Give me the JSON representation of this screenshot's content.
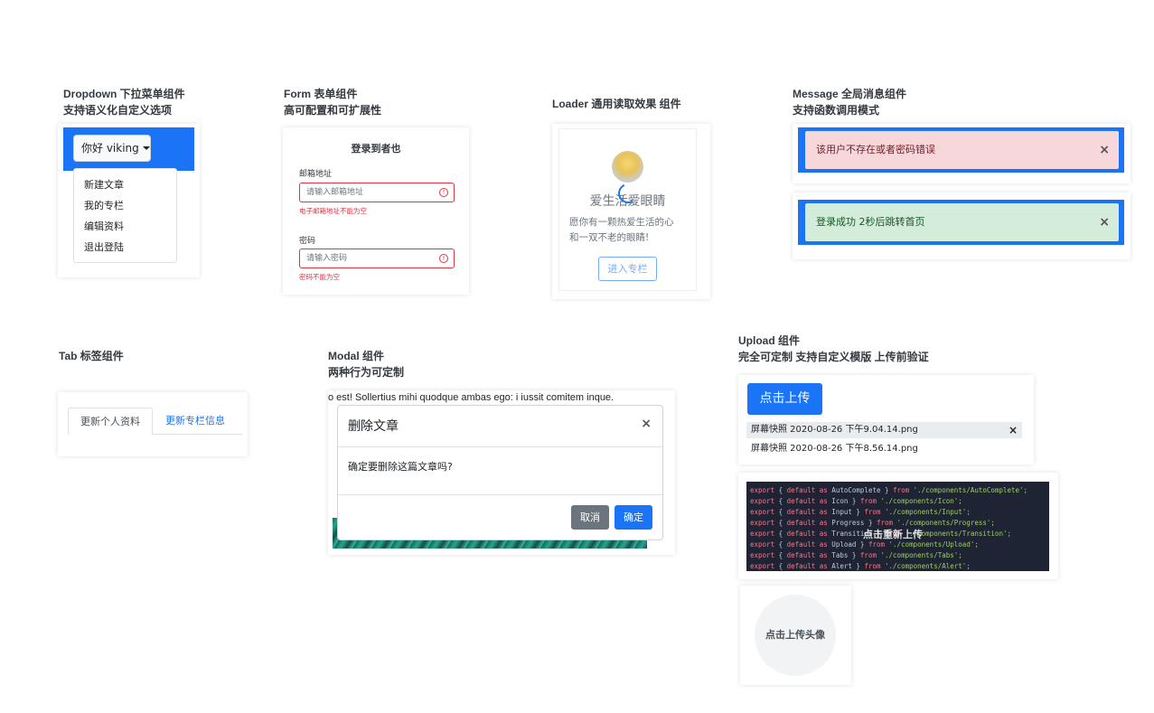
{
  "sections": {
    "dropdown": {
      "title1": "Dropdown 下拉菜单组件",
      "title2": "支持语义化自定义选项"
    },
    "form": {
      "title1": "Form 表单组件",
      "title2": "高可配置和可扩展性"
    },
    "loader": {
      "title1": "Loader 通用读取效果 组件"
    },
    "message": {
      "title1": "Message 全局消息组件",
      "title2": "支持函数调用模式"
    },
    "tab": {
      "title1": "Tab 标签组件"
    },
    "modal": {
      "title1": "Modal 组件",
      "title2": "两种行为可定制"
    },
    "upload": {
      "title1": "Upload 组件",
      "title2": "完全可定制 支持自定义模版 上传前验证"
    }
  },
  "dropdown": {
    "button_label": "你好 viking",
    "items": [
      "新建文章",
      "我的专栏",
      "编辑资料",
      "退出登陆"
    ]
  },
  "form": {
    "heading": "登录到者也",
    "email_label": "邮箱地址",
    "email_placeholder": "请输入邮箱地址",
    "email_error": "电子邮箱地址不能为空",
    "password_label": "密码",
    "password_placeholder": "请输入密码",
    "password_error": "密码不能为空",
    "error_glyph": "!"
  },
  "loader": {
    "heading": "爱生活爱眼睛",
    "desc_line1": "愿你有一颗热爱生活的心",
    "desc_line2": "和一双不老的眼睛!",
    "button": "进入专栏"
  },
  "message": {
    "error_text": "该用户不存在或者密码错误",
    "success_text": "登录成功 2秒后跳转首页",
    "close_glyph": "×"
  },
  "tabs": {
    "items": [
      "更新个人资料",
      "更新专栏信息"
    ]
  },
  "modal": {
    "bg_line1": "o est! Sollertius mihi quodque ambas ego: i iussit comitem inque.",
    "title": "删除文章",
    "body": "确定要删除这篇文章吗?",
    "cancel": "取消",
    "confirm": "确定",
    "close_glyph": "×"
  },
  "upload": {
    "button": "点击上传",
    "files": [
      "屏幕快照 2020-08-26 下午9.04.14.png",
      "屏幕快照 2020-08-26 下午8.56.14.png"
    ],
    "remove_glyph": "×",
    "code_overlay": "点击重新上传",
    "code_lines": [
      [
        "export",
        " { ",
        "default as",
        " AutoComplete } ",
        "from",
        " './components/AutoComplete';"
      ],
      [
        "export",
        " { ",
        "default as",
        " Icon } ",
        "from",
        " './components/Icon';"
      ],
      [
        "export",
        " { ",
        "default as",
        " Input } ",
        "from",
        " './components/Input';"
      ],
      [
        "export",
        " { ",
        "default as",
        " Progress } ",
        "from",
        " './components/Progress';"
      ],
      [
        "export",
        " { ",
        "default as",
        " Transition } ",
        "from",
        " './components/Transition';"
      ],
      [
        "export",
        " { ",
        "default as",
        " Upload } ",
        "from",
        " './components/Upload';"
      ],
      [
        "export",
        " { ",
        "default as",
        " Tabs } ",
        "from",
        " './components/Tabs';"
      ],
      [
        "export",
        " { ",
        "default as",
        " Alert } ",
        "from",
        " './components/Alert';"
      ]
    ],
    "avatar_label": "点击上传头像"
  },
  "colors": {
    "primary": "#1a74f5",
    "danger": "#dc3545",
    "error_bg": "#f8d7da",
    "error_text": "#721c24",
    "success_bg": "#d4edda",
    "success_text": "#155724"
  }
}
